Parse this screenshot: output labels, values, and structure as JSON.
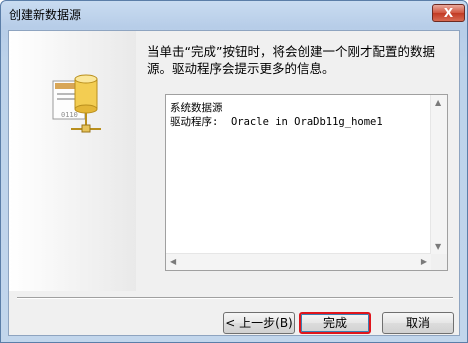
{
  "window": {
    "title": "创建新数据源",
    "close_glyph": "X"
  },
  "info_text": "当单击“完成”按钮时，将会创建一个刚才配置的数据源。驱动程序会提示更多的信息。",
  "details": {
    "line1": "系统数据源",
    "line2": "驱动程序:  Oracle in OraDb11g_home1"
  },
  "buttons": {
    "back": "< 上一步(B)",
    "finish": "完成",
    "cancel": "取消"
  },
  "icons": {
    "wizard": "datasource-wizard-icon"
  },
  "colors": {
    "accent_focus": "#e0151c",
    "close_red": "#c13a23"
  }
}
